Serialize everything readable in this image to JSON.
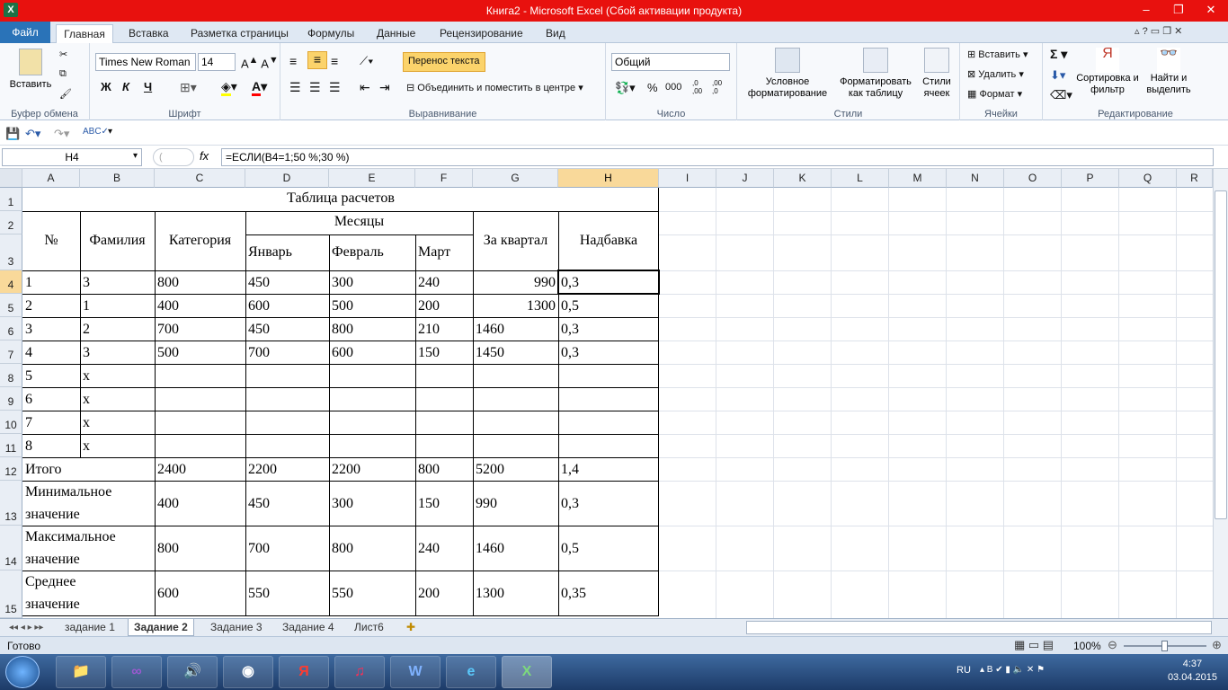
{
  "window": {
    "title": "Книга2 - Microsoft Excel (Сбой активации продукта)"
  },
  "tabs": [
    "Файл",
    "Главная",
    "Вставка",
    "Разметка страницы",
    "Формулы",
    "Данные",
    "Рецензирование",
    "Вид"
  ],
  "ribbon": {
    "clipboard": {
      "paste": "Вставить",
      "label": "Буфер обмена"
    },
    "font": {
      "name": "Times New Roman",
      "size": "14",
      "bold": "Ж",
      "italic": "К",
      "underline": "Ч",
      "label": "Шрифт"
    },
    "alignment": {
      "wrap": "Перенос текста",
      "merge": "Объединить и поместить в центре",
      "label": "Выравнивание"
    },
    "number": {
      "format": "Общий",
      "percent": "%",
      "thousands": "000",
      "inc": ",0 ,00",
      "dec": ",00 ,0",
      "label": "Число"
    },
    "styles": {
      "cond": "Условное форматирование",
      "table": "Форматировать как таблицу",
      "cell": "Стили ячеек",
      "label": "Стили"
    },
    "cells": {
      "insert": "Вставить",
      "delete": "Удалить",
      "format": "Формат",
      "label": "Ячейки"
    },
    "editing": {
      "sum": "Σ",
      "sort": "Сортировка и фильтр",
      "find": "Найти и выделить",
      "label": "Редактирование"
    }
  },
  "formula_bar": {
    "name_box": "H4",
    "fx": "fx",
    "formula": "=ЕСЛИ(B4=1;50 %;30 %)"
  },
  "columns": [
    "A",
    "B",
    "C",
    "D",
    "E",
    "F",
    "G",
    "H",
    "I",
    "J",
    "K",
    "L",
    "M",
    "N",
    "O",
    "P",
    "Q",
    "R"
  ],
  "rows": [
    "1",
    "2",
    "3",
    "4",
    "5",
    "6",
    "7",
    "8",
    "9",
    "10",
    "11",
    "12",
    "13",
    "14",
    "15"
  ],
  "table": {
    "title": "Таблица расчетов",
    "h_num": "№",
    "h_name": "Фамилия",
    "h_cat": "Категория",
    "h_months": "Месяцы",
    "h_jan": "Январь",
    "h_feb": "Февраль",
    "h_mar": "Март",
    "h_q": "За квартал",
    "h_bonus": "Надбавка",
    "data": [
      [
        "1",
        "3",
        "800",
        "450",
        "300",
        "240",
        "990",
        "0,3"
      ],
      [
        "2",
        "1",
        "400",
        "600",
        "500",
        "200",
        "1300",
        "0,5"
      ],
      [
        "3",
        "2",
        "700",
        "450",
        "800",
        "210",
        "1460",
        "0,3"
      ],
      [
        "4",
        "3",
        "500",
        "700",
        "600",
        "150",
        "1450",
        "0,3"
      ],
      [
        "5",
        "x",
        "",
        "",
        "",
        "",
        "",
        ""
      ],
      [
        "6",
        "x",
        "",
        "",
        "",
        "",
        "",
        ""
      ],
      [
        "7",
        "x",
        "",
        "",
        "",
        "",
        "",
        ""
      ],
      [
        "8",
        "x",
        "",
        "",
        "",
        "",
        "",
        ""
      ]
    ],
    "total": [
      "Итого",
      "2400",
      "2200",
      "2200",
      "800",
      "5200",
      "1,4"
    ],
    "min": [
      "Минимальное",
      "значение",
      "400",
      "450",
      "300",
      "150",
      "990",
      "0,3"
    ],
    "max": [
      "Максимальное",
      "значение",
      "800",
      "700",
      "800",
      "240",
      "1460",
      "0,5"
    ],
    "avg": [
      "Среднее",
      "значение",
      "600",
      "550",
      "550",
      "200",
      "1300",
      "0,35"
    ]
  },
  "sheets": [
    "задание 1",
    "Задание 2",
    "Задание 3",
    "Задание 4",
    "Лист6"
  ],
  "status": {
    "ready": "Готово",
    "zoom": "100%"
  },
  "tray": {
    "lang": "RU",
    "time": "4:37",
    "date": "03.04.2015"
  }
}
